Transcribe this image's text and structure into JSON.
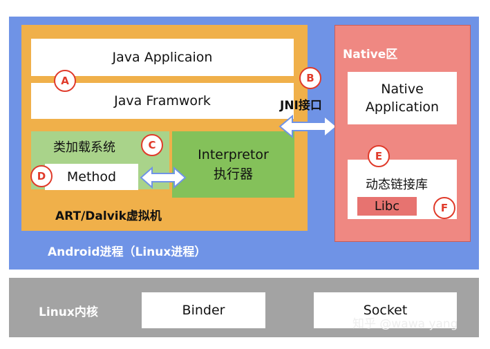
{
  "android_process": {
    "label": "Android进程（Linux进程）"
  },
  "art": {
    "label": "ART/Dalvik虚拟机",
    "java_app": "Java Applicaion",
    "java_framework": "Java Framwork",
    "class_loader": "类加载系统",
    "method": "Method",
    "interpreter_line1": "Interpretor",
    "interpreter_line2": "执行器"
  },
  "jni": {
    "label": "JNI接口"
  },
  "native": {
    "title": "Native区",
    "app_line1": "Native",
    "app_line2": "Application",
    "dynamic_lib": "动态链接库",
    "libc": "Libc"
  },
  "kernel": {
    "label": "Linux内核",
    "binder": "Binder",
    "socket": "Socket"
  },
  "markers": {
    "a": "A",
    "b": "B",
    "c": "C",
    "d": "D",
    "e": "E",
    "f": "F"
  },
  "watermark": "知乎 @wawa yang",
  "colors": {
    "android_blue": "#6f93e6",
    "art_orange": "#f0b04a",
    "classloader_green": "#a9d38a",
    "interpreter_green": "#84c15a",
    "native_red": "#ef8882",
    "libc_red": "#e77370",
    "kernel_gray": "#a3a3a3",
    "marker_red": "#e03a2a"
  }
}
